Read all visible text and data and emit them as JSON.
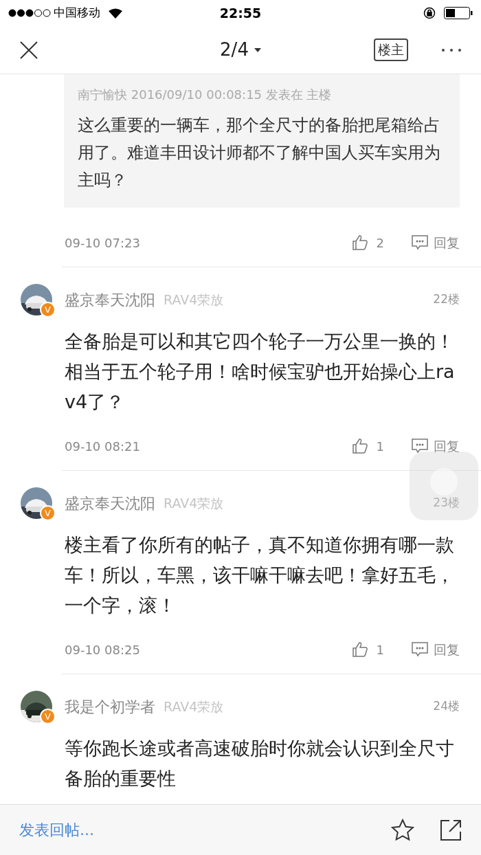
{
  "status_bar": {
    "carrier": "中国移动",
    "time": "22:55"
  },
  "nav": {
    "page": "2/4",
    "op_button": "楼主"
  },
  "quoted_post": {
    "header": "南宁愉快 2016/09/10 00:08:15 发表在 主楼",
    "text": "这么重要的一辆车，那个全尺寸的备胎把尾箱给占用了。难道丰田设计师都不了解中国人买车实用为主吗？"
  },
  "first_footer": {
    "time": "09-10 07:23",
    "likes": "2",
    "reply": "回复"
  },
  "posts": [
    {
      "name": "盛京奉天沈阳",
      "tag": "RAV4荣放",
      "floor": "22楼",
      "badge": "V",
      "content": "全备胎是可以和其它四个轮子一万公里一换的！相当于五个轮子用！啥时候宝驴也开始操心上rav4了？",
      "time": "09-10 08:21",
      "likes": "1",
      "reply": "回复"
    },
    {
      "name": "盛京奉天沈阳",
      "tag": "RAV4荣放",
      "floor": "23楼",
      "badge": "V",
      "content": "楼主看了你所有的帖子，真不知道你拥有哪一款车！所以，车黑，该干嘛干嘛去吧！拿好五毛，一个字，滚！",
      "time": "09-10 08:25",
      "likes": "1",
      "reply": "回复"
    },
    {
      "name": "我是个初学者",
      "tag": "RAV4荣放",
      "floor": "24楼",
      "badge": "V",
      "content": "等你跑长途或者高速破胎时你就会认识到全尺寸备胎的重要性"
    }
  ],
  "bottom_bar": {
    "placeholder": "发表回帖..."
  }
}
